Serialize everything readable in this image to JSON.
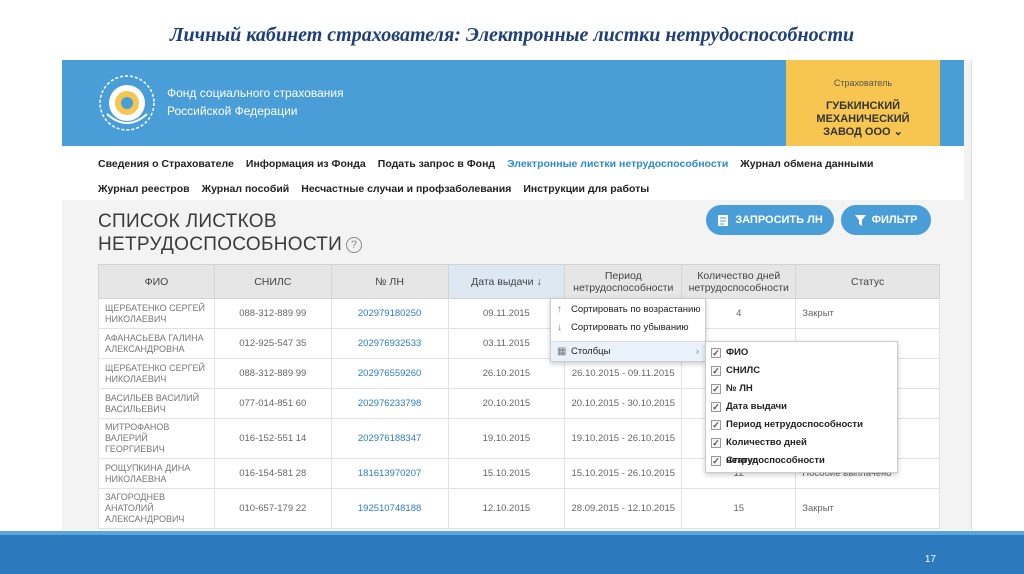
{
  "slide": {
    "title": "Личный кабинет страхователя: Электронные листки нетрудоспособности",
    "page_number": "17"
  },
  "header": {
    "org_line1": "Фонд социального страхования",
    "org_line2": "Российской Федерации",
    "insurer_label": "Страхователь",
    "insurer_name": "ГУБКИНСКИЙ МЕХАНИЧЕСКИЙ ЗАВОД ООО",
    "insurer_chevron": "chevron-down-icon"
  },
  "nav": {
    "row1": [
      "Сведения о Страхователе",
      "Информация из Фонда",
      "Подать запрос в Фонд",
      "Электронные листки нетрудоспособности",
      "Журнал обмена данными"
    ],
    "row2": [
      "Журнал реестров",
      "Журнал пособий",
      "Несчастные случаи и профзаболевания",
      "Инструкции для работы"
    ],
    "active": "Электронные листки нетрудоспособности"
  },
  "page": {
    "title_line1": "СПИСОК ЛИСТКОВ",
    "title_line2": "НЕТРУДОСПОСОБНОСТИ",
    "help": "?",
    "request_button": "ЗАПРОСИТЬ ЛН",
    "filter_button": "ФИЛЬТР"
  },
  "table": {
    "headers": [
      "ФИО",
      "СНИЛС",
      "№ ЛН",
      "Дата выдачи",
      "Период нетрудоспособности",
      "Количество дней нетрудоспособности",
      "Статус"
    ],
    "sort_indicator": "↓",
    "rows": [
      {
        "fio": "ЩЕРБАТЕНКО СЕРГЕЙ НИКОЛАЕВИЧ",
        "snils": "088-312-889 99",
        "ln": "202979180250",
        "date": "09.11.2015",
        "period": "",
        "days": "4",
        "status": "Закрыт"
      },
      {
        "fio": "АФАНАСЬЕВА ГАЛИНА АЛЕКСАНДРОВНА",
        "snils": "012-925-547 35",
        "ln": "202976932533",
        "date": "03.11.2015",
        "period": "",
        "days": "",
        "status": "...ы"
      },
      {
        "fio": "ЩЕРБАТЕНКО СЕРГЕЙ НИКОЛАЕВИЧ",
        "snils": "088-312-889 99",
        "ln": "202976559260",
        "date": "26.10.2015",
        "period": "26.10.2015 - 09.11.2015",
        "days": "",
        "status": ""
      },
      {
        "fio": "ВАСИЛЬЕВ ВАСИЛИЙ ВАСИЛЬЕВИЧ",
        "snils": "077-014-851 60",
        "ln": "202976233798",
        "date": "20.10.2015",
        "period": "20.10.2015 - 30.10.2015",
        "days": "",
        "status": ""
      },
      {
        "fio": "МИТРОФАНОВ ВАЛЕРИЙ ГЕОРГИЕВИЧ",
        "snils": "016-152-551 14",
        "ln": "202976188347",
        "date": "19.10.2015",
        "period": "19.10.2015 - 26.10.2015",
        "days": "",
        "status": ""
      },
      {
        "fio": "РОЩУПКИНА ДИНА НИКОЛАЕВНА",
        "snils": "016-154-581 28",
        "ln": "181613970207",
        "date": "15.10.2015",
        "period": "15.10.2015 - 26.10.2015",
        "days": "12",
        "status": "Пособие выплачено"
      },
      {
        "fio": "ЗАГОРОДНЕВ АНАТОЛИЙ АЛЕКСАНДРОВИЧ",
        "snils": "010-657-179 22",
        "ln": "192510748188",
        "date": "12.10.2015",
        "period": "28.09.2015 - 12.10.2015",
        "days": "15",
        "status": "Закрыт"
      }
    ]
  },
  "dropdown": {
    "sort_asc": "Сортировать по возрастанию",
    "sort_desc": "Сортировать по убыванию",
    "columns": "Столбцы"
  },
  "columns_menu": {
    "items": [
      "ФИО",
      "СНИЛС",
      "№ ЛН",
      "Дата выдачи",
      "Период нетрудоспособности",
      "Количество дней нетрудоспособности",
      "Статус"
    ]
  },
  "colors": {
    "header_blue": "#4a9ed8",
    "insurer_yellow": "#f6c651",
    "link_blue": "#2d7bc4",
    "footer_blue": "#2d79bd"
  }
}
